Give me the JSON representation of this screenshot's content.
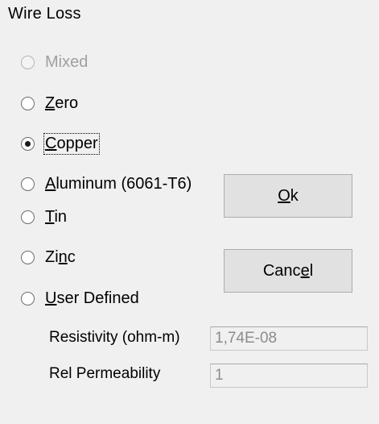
{
  "dialog": {
    "title": "Wire Loss"
  },
  "options": [
    {
      "key": "mixed",
      "pre": "Mixed",
      "u": "",
      "post": "",
      "checked": false,
      "disabled": true
    },
    {
      "key": "zero",
      "pre": "",
      "u": "Z",
      "post": "ero",
      "checked": false,
      "disabled": false
    },
    {
      "key": "copper",
      "pre": "",
      "u": "C",
      "post": "opper",
      "checked": true,
      "disabled": false
    },
    {
      "key": "aluminum",
      "pre": "",
      "u": "A",
      "post": "luminum (6061-T6)",
      "checked": false,
      "disabled": false
    },
    {
      "key": "tin",
      "pre": "",
      "u": "T",
      "post": "in",
      "checked": false,
      "disabled": false
    },
    {
      "key": "zinc",
      "pre": "Zi",
      "u": "n",
      "post": "c",
      "checked": false,
      "disabled": false
    },
    {
      "key": "user-defined",
      "pre": "",
      "u": "U",
      "post": "ser Defined",
      "checked": false,
      "disabled": false
    }
  ],
  "buttons": {
    "ok": {
      "pre": "",
      "u": "O",
      "post": "k"
    },
    "cancel": {
      "pre": "Canc",
      "u": "e",
      "post": "l"
    }
  },
  "fields": {
    "resistivity": {
      "label": "Resistivity (ohm-m)",
      "value": "1,74E-08"
    },
    "permeability": {
      "label": "Rel Permeability",
      "value": "1"
    }
  }
}
